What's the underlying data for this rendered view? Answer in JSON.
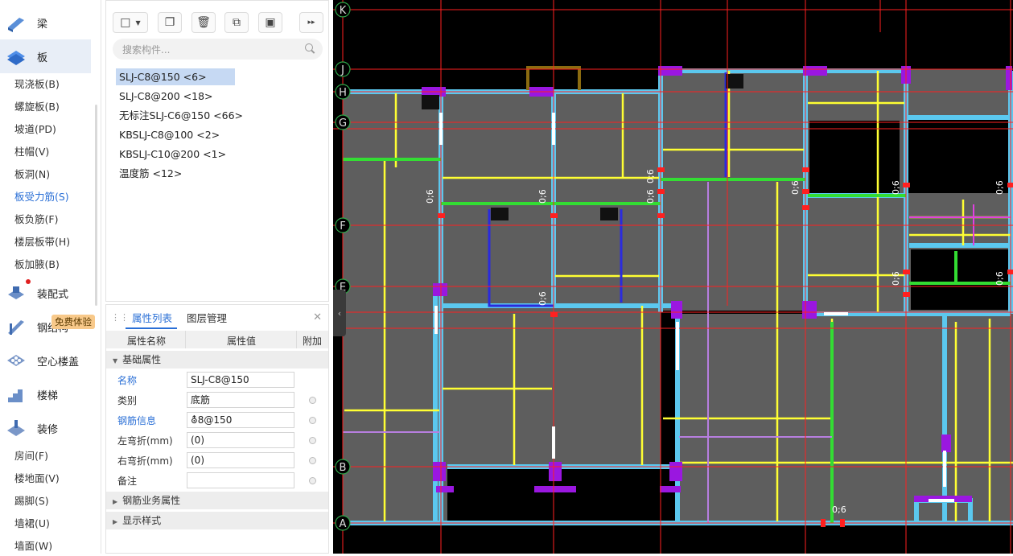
{
  "left_nav": {
    "categories": [
      {
        "label": "梁",
        "icon": "beam-icon"
      },
      {
        "label": "板",
        "icon": "slab-icon"
      },
      {
        "label": "装配式",
        "icon": "prefab-icon"
      },
      {
        "label": "钢结构",
        "icon": "steel-structure-icon"
      },
      {
        "label": "空心楼盖",
        "icon": "hollow-floor-icon"
      },
      {
        "label": "楼梯",
        "icon": "stairs-icon"
      },
      {
        "label": "装修",
        "icon": "decoration-icon"
      }
    ],
    "slab_items": [
      "现浇板(B)",
      "螺旋板(B)",
      "坡道(PD)",
      "柱帽(V)",
      "板洞(N)",
      "板受力筋(S)",
      "板负筋(F)",
      "楼层板带(H)",
      "板加腋(B)"
    ],
    "selected_item": "板受力筋(S)",
    "decoration_items": [
      "房间(F)",
      "楼地面(V)",
      "踢脚(S)",
      "墙裙(U)",
      "墙面(W)"
    ],
    "badge": "免费体验",
    "accent_color": "#2a6fd6"
  },
  "component_panel": {
    "search_placeholder": "搜索构件...",
    "items": [
      "SLJ-C8@150 <6>",
      "SLJ-C8@200 <18>",
      "无标注SLJ-C6@150 <66>",
      "KBSLJ-C8@100 <2>",
      "KBSLJ-C10@200 <1>",
      "温度筋 <12>"
    ]
  },
  "properties": {
    "tabs": [
      "属性列表",
      "图层管理"
    ],
    "headers": [
      "属性名称",
      "属性值",
      "附加"
    ],
    "group_basic": "基础属性",
    "rows": [
      {
        "name": "名称",
        "value": "SLJ-C8@150"
      },
      {
        "name": "类别",
        "value": "底筋"
      },
      {
        "name": "钢筋信息",
        "value": "⛢8@150"
      },
      {
        "name": "左弯折(mm)",
        "value": "(0)"
      },
      {
        "name": "右弯折(mm)",
        "value": "(0)"
      },
      {
        "name": "备注",
        "value": ""
      }
    ],
    "group_business": "钢筋业务属性",
    "group_display": "显示样式"
  },
  "canvas": {
    "axis_labels": [
      "K",
      "J",
      "H",
      "G",
      "F",
      "E",
      "B",
      "A"
    ],
    "dimension_label": "0;6",
    "colors": {
      "background": "#000000",
      "slab": "#5e5e5e",
      "beam": "#5bc8ef",
      "rebar": "#ffff33",
      "distribution": "#33dd33",
      "axis": "#ff2020",
      "column": "#9a17e0"
    }
  }
}
